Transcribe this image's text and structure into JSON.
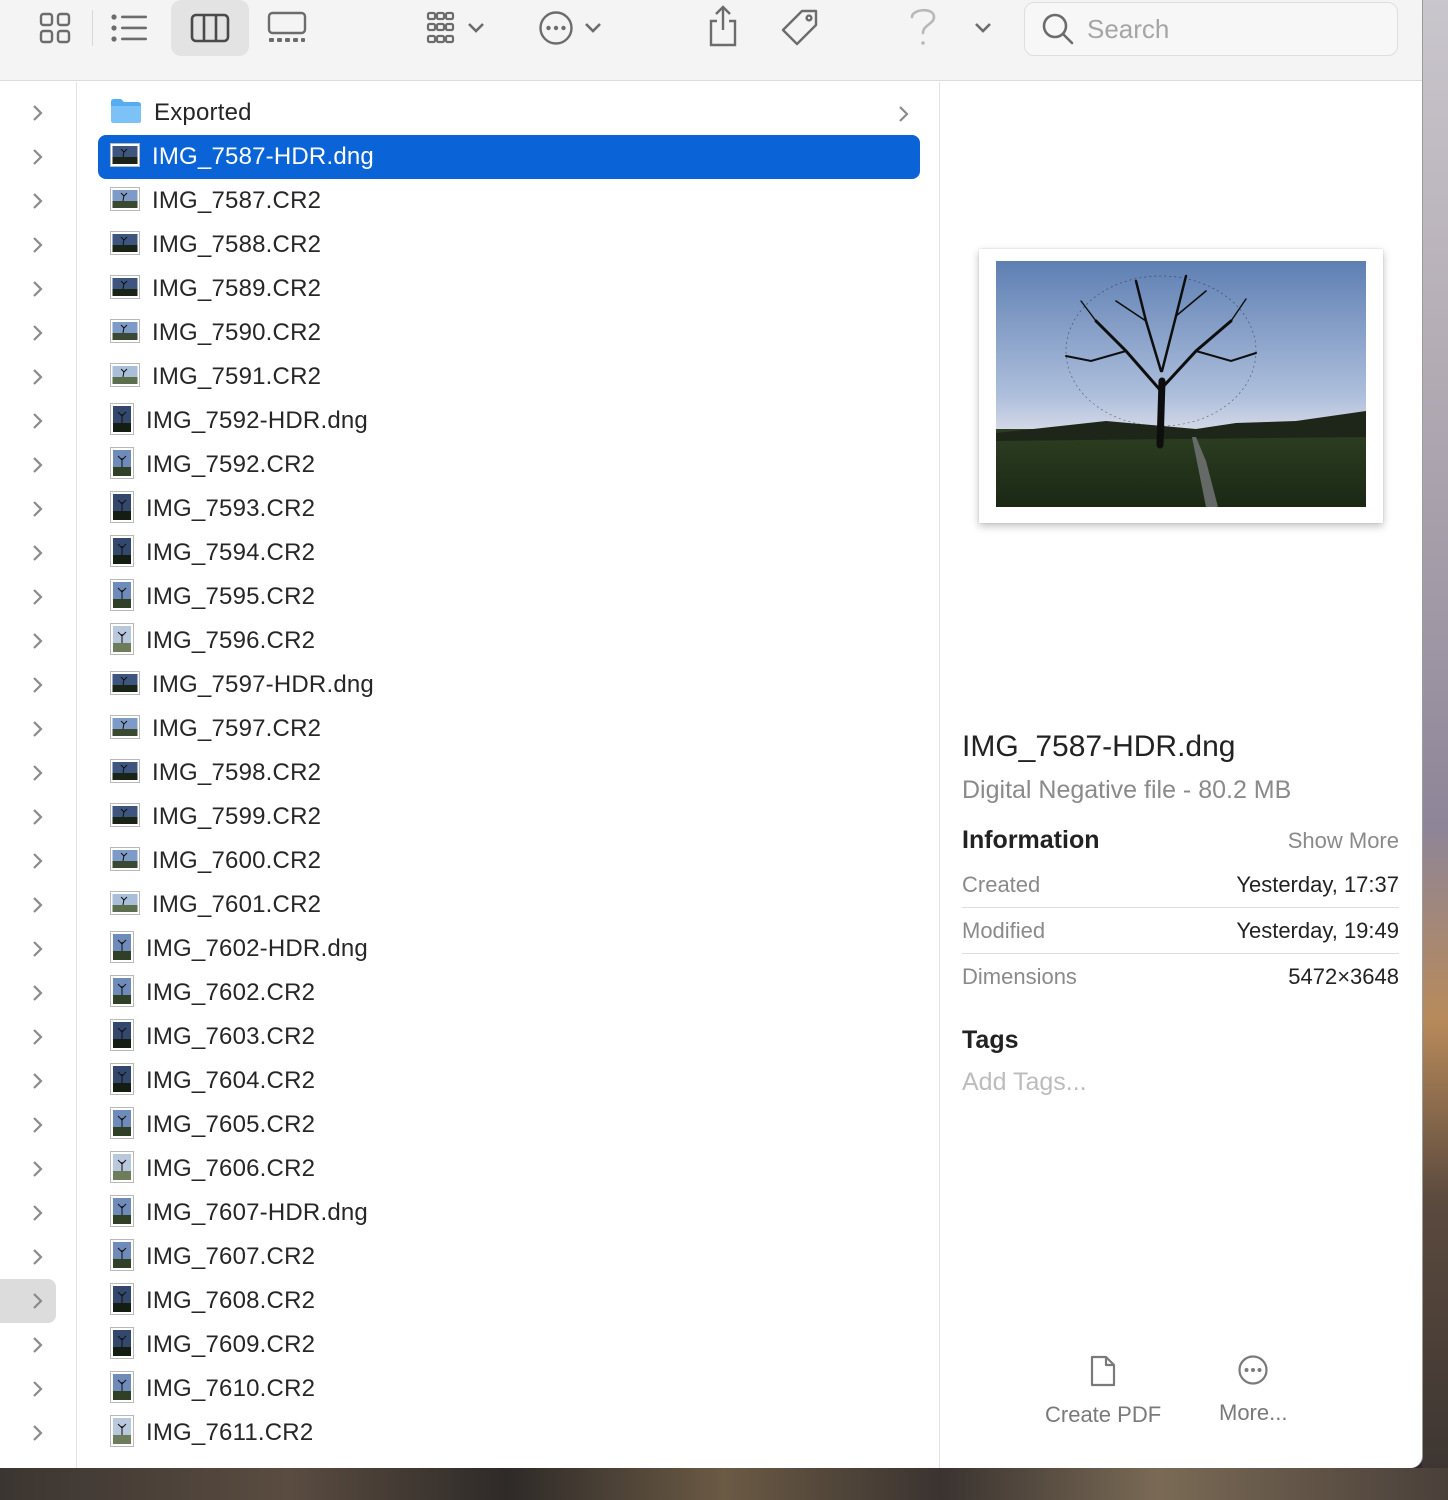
{
  "toolbar": {
    "icons": [
      "icon-view-grid-icon",
      "list-view-icon",
      "column-view-icon",
      "gallery-view-icon",
      "group-icon",
      "chevron-down-icon",
      "action-ellipsis-icon",
      "share-icon",
      "tag-icon",
      "help-icon"
    ],
    "search_placeholder": "Search"
  },
  "files": [
    {
      "name": "Exported",
      "type": "folder"
    },
    {
      "name": "IMG_7587-HDR.dng",
      "type": "landscape-dark",
      "selected": true
    },
    {
      "name": "IMG_7587.CR2",
      "type": "landscape"
    },
    {
      "name": "IMG_7588.CR2",
      "type": "landscape-dark"
    },
    {
      "name": "IMG_7589.CR2",
      "type": "landscape-dark"
    },
    {
      "name": "IMG_7590.CR2",
      "type": "landscape"
    },
    {
      "name": "IMG_7591.CR2",
      "type": "landscape-light"
    },
    {
      "name": "IMG_7592-HDR.dng",
      "type": "portrait-dark"
    },
    {
      "name": "IMG_7592.CR2",
      "type": "portrait"
    },
    {
      "name": "IMG_7593.CR2",
      "type": "portrait-dark"
    },
    {
      "name": "IMG_7594.CR2",
      "type": "portrait-dark"
    },
    {
      "name": "IMG_7595.CR2",
      "type": "portrait"
    },
    {
      "name": "IMG_7596.CR2",
      "type": "portrait-light"
    },
    {
      "name": "IMG_7597-HDR.dng",
      "type": "landscape-dark"
    },
    {
      "name": "IMG_7597.CR2",
      "type": "landscape"
    },
    {
      "name": "IMG_7598.CR2",
      "type": "landscape-dark"
    },
    {
      "name": "IMG_7599.CR2",
      "type": "landscape-dark"
    },
    {
      "name": "IMG_7600.CR2",
      "type": "landscape"
    },
    {
      "name": "IMG_7601.CR2",
      "type": "landscape-light"
    },
    {
      "name": "IMG_7602-HDR.dng",
      "type": "portrait"
    },
    {
      "name": "IMG_7602.CR2",
      "type": "portrait"
    },
    {
      "name": "IMG_7603.CR2",
      "type": "portrait-dark"
    },
    {
      "name": "IMG_7604.CR2",
      "type": "portrait-dark"
    },
    {
      "name": "IMG_7605.CR2",
      "type": "portrait"
    },
    {
      "name": "IMG_7606.CR2",
      "type": "portrait-light"
    },
    {
      "name": "IMG_7607-HDR.dng",
      "type": "portrait"
    },
    {
      "name": "IMG_7607.CR2",
      "type": "portrait"
    },
    {
      "name": "IMG_7608.CR2",
      "type": "portrait-dark"
    },
    {
      "name": "IMG_7609.CR2",
      "type": "portrait-dark"
    },
    {
      "name": "IMG_7610.CR2",
      "type": "portrait"
    },
    {
      "name": "IMG_7611.CR2",
      "type": "portrait-light"
    }
  ],
  "preview": {
    "title": "IMG_7587-HDR.dng",
    "subtitle": "Digital Negative file - 80.2 MB",
    "information_heading": "Information",
    "show_more": "Show More",
    "info": [
      {
        "label": "Created",
        "value": "Yesterday, 17:37"
      },
      {
        "label": "Modified",
        "value": "Yesterday, 19:49"
      },
      {
        "label": "Dimensions",
        "value": "5472×3648"
      }
    ],
    "tags_heading": "Tags",
    "add_tags": "Add Tags...",
    "actions": [
      {
        "label": "Create PDF",
        "icon": "document-icon"
      },
      {
        "label": "More...",
        "icon": "ellipsis-circle-icon"
      }
    ]
  },
  "colors": {
    "selection": "#0a64d8",
    "toolbar_bg": "#f4f4f4",
    "folder": "#4aa8f0"
  }
}
